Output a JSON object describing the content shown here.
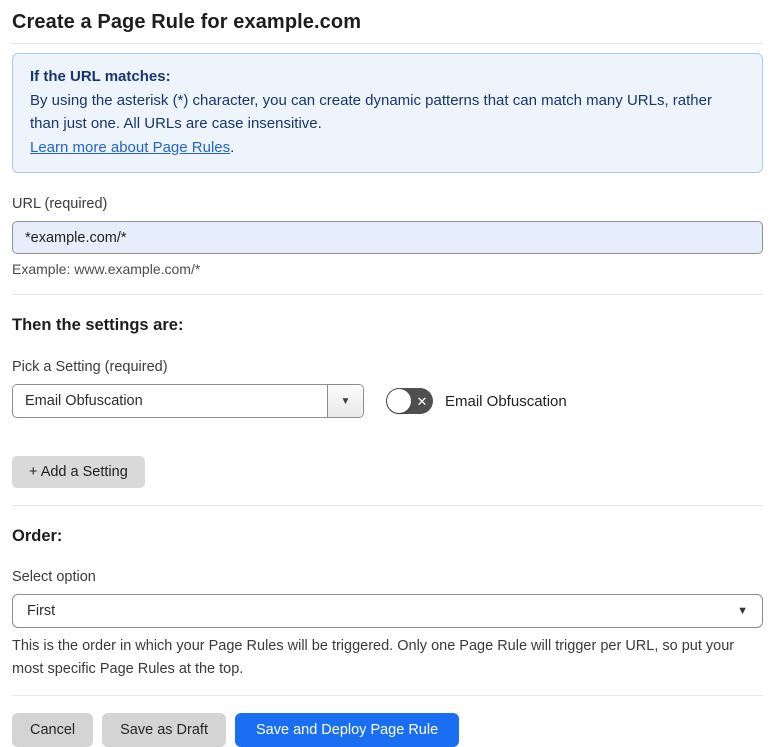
{
  "page": {
    "title": "Create a Page Rule for example.com"
  },
  "callout": {
    "heading": "If the URL matches:",
    "body": "By using the asterisk (*) character, you can create dynamic patterns that can match many URLs, rather than just one. All URLs are case insensitive.",
    "link": "Learn more about Page Rules",
    "link_suffix": "."
  },
  "url_field": {
    "label": "URL (required)",
    "value": "*example.com/*",
    "helper": "Example: www.example.com/*"
  },
  "settings": {
    "heading": "Then the settings are:",
    "pick_label": "Pick a Setting (required)",
    "selected_setting": "Email Obfuscation",
    "toggle": {
      "state": "off",
      "label": "Email Obfuscation"
    },
    "add_button": "+ Add a Setting"
  },
  "order": {
    "heading": "Order:",
    "select_label": "Select option",
    "selected_option": "First",
    "description": "This is the order in which your Page Rules will be triggered. Only one Page Rule will trigger per URL, so put your most specific Page Rules at the top."
  },
  "footer": {
    "cancel": "Cancel",
    "save_draft": "Save as Draft",
    "save_deploy": "Save and Deploy Page Rule"
  },
  "icons": {
    "chevron_down": "▼",
    "toggle_x": "✕"
  },
  "colors": {
    "primary_blue": "#1a6ef2",
    "callout_bg": "#edf4fc",
    "callout_border": "#a9cdf0",
    "callout_text": "#17356b",
    "link_blue": "#2264c7",
    "input_bg": "#e7eefb",
    "toggle_off": "#4f4f4f",
    "button_gray": "#d4d4d4"
  }
}
